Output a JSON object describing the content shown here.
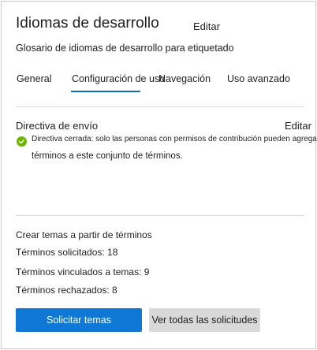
{
  "header": {
    "title": "Idiomas de desarrollo",
    "edit_label": "Editar",
    "subtitle": "Glosario de idiomas de desarrollo para etiquetado"
  },
  "tabs": [
    {
      "label": "General"
    },
    {
      "label": "Configuración de uso",
      "active": true
    },
    {
      "label": "Navegación"
    },
    {
      "label": "Uso avanzado"
    }
  ],
  "policy": {
    "title": "Directiva de envío",
    "edit_label": "Editar",
    "line1": "Directiva cerrada: solo las personas con permisos de contribución pueden agregar",
    "line2": "términos a este conjunto de términos.",
    "icon": "check-circle-icon",
    "status_color": "#6bb700"
  },
  "topics": {
    "heading": "Crear temas a partir de términos",
    "requested": "Términos solicitados: 18",
    "linked": "Términos vinculados a temas: 9",
    "rejected": "Términos rechazados: 8"
  },
  "buttons": {
    "request_topics": "Solicitar temas",
    "view_all_requests": "Ver todas las solicitudes"
  },
  "colors": {
    "accent": "#0f6cbd",
    "primary_button": "#0f78d4"
  }
}
